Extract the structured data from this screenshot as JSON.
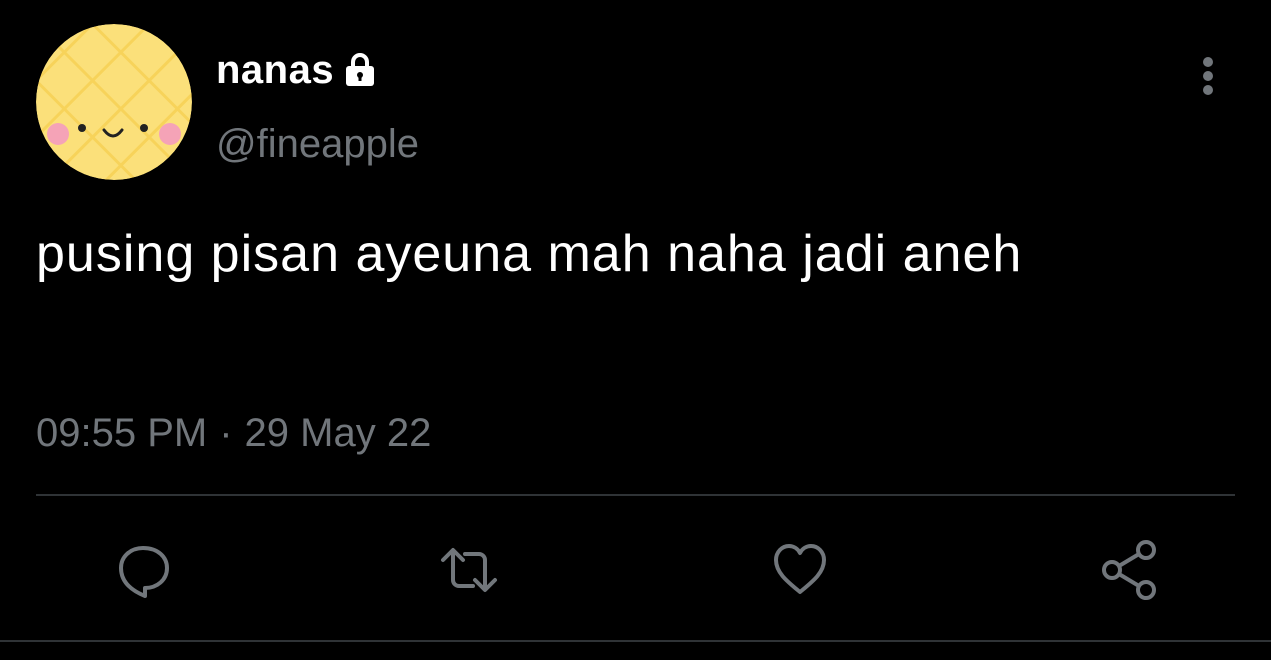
{
  "tweet": {
    "display_name": "nanas",
    "handle": "@fineapple",
    "text": "pusing pisan ayeuna mah naha jadi aneh",
    "time": "09:55 PM",
    "separator": "·",
    "date": "29 May 22",
    "protected_icon": "lock-icon"
  },
  "actions": [
    {
      "name": "reply",
      "icon": "reply-icon"
    },
    {
      "name": "retweet",
      "icon": "retweet-icon"
    },
    {
      "name": "like",
      "icon": "heart-icon"
    },
    {
      "name": "share",
      "icon": "share-icon"
    }
  ],
  "colors": {
    "background": "#000000",
    "primary_text": "#ffffff",
    "secondary_text": "#71767b",
    "divider": "#2f3336",
    "avatar_fill": "#fbe07a",
    "avatar_blush": "#f5a3b7"
  }
}
